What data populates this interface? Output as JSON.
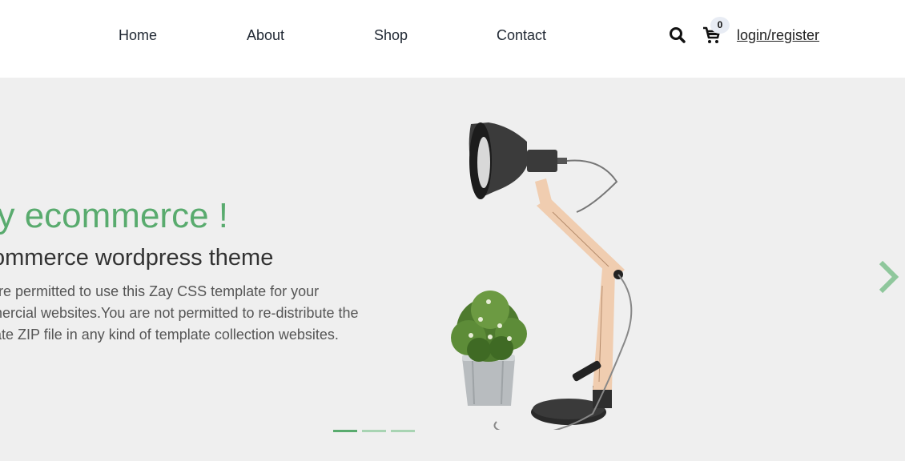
{
  "nav": {
    "links": [
      "Home",
      "About",
      "Shop",
      "Contact"
    ],
    "cart_count": "0",
    "login_label": "login/register"
  },
  "hero": {
    "title": "ay ecommerce !",
    "subtitle": "ommerce wordpress theme",
    "text_lines": [
      "are permitted to use this Zay CSS template for your",
      "mercial websites.You are not permitted to re-distribute the",
      "late ZIP file in any kind of template collection websites."
    ]
  },
  "carousel": {
    "active_slide": 1,
    "slide_count": 3
  },
  "colors": {
    "accent": "#59ab6e",
    "hero_bg": "#efefef"
  },
  "icons": [
    "search-icon",
    "cart-icon",
    "chevron-right-icon"
  ]
}
